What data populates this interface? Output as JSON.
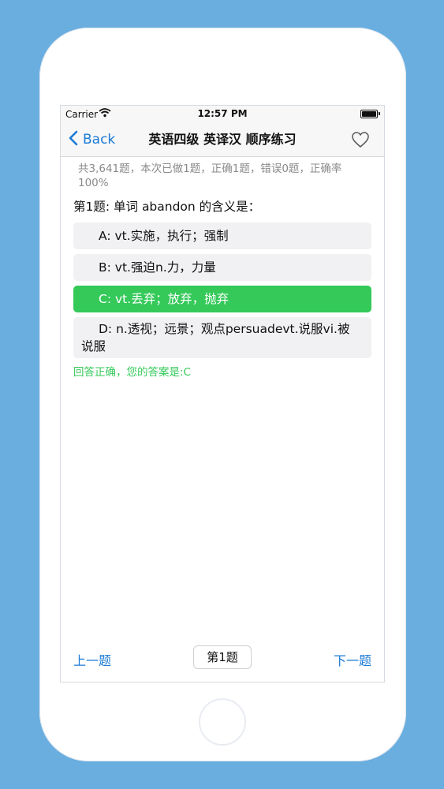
{
  "status": {
    "carrier": "Carrier",
    "time": "12:57 PM"
  },
  "nav": {
    "back_label": "Back",
    "title": "英语四级 英译汉 顺序练习"
  },
  "stats": "共3,641题，本次已做1题，正确1题，错误0题，正确率100%",
  "question": "第1题: 单词 abandon 的含义是：",
  "options": [
    {
      "text": "A: vt.实施，执行；强制"
    },
    {
      "text": "B: vt.强迫n.力，力量"
    },
    {
      "text": "C: vt.丢弃；放弃，抛弃",
      "state": "correct"
    },
    {
      "line1": "D: n.透视；远景；观点persuadevt.说服vi.被",
      "line2": "说服"
    }
  ],
  "feedback": "回答正确，您的答案是:C",
  "bottom": {
    "prev_label": "上一题",
    "page_label": "第1题",
    "next_label": "下一题"
  },
  "colors": {
    "background": "#6aaee0",
    "accent": "#1b7bd6",
    "correct": "#35c95a"
  },
  "icons": {
    "back": "chevron-left-icon",
    "favorite": "heart-outline-icon",
    "wifi": "wifi-icon",
    "battery": "battery-icon"
  }
}
